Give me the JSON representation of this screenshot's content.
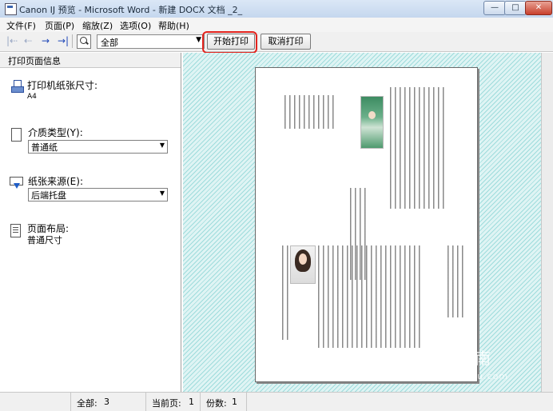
{
  "window": {
    "title": "Canon IJ 预览 - Microsoft Word - 新建 DOCX 文档 _2_",
    "controls": {
      "minimize": "—",
      "maximize": "□",
      "close": "✕"
    }
  },
  "menu": {
    "items": [
      "文件(F)",
      "页面(P)",
      "缩放(Z)",
      "选项(O)",
      "帮助(H)"
    ]
  },
  "toolbar": {
    "nav_icons": {
      "first": "|⇠",
      "prev": "⇠",
      "next": "→",
      "last": "→|"
    },
    "pages_select": "全部",
    "start_print": "开始打印",
    "cancel_print": "取消打印"
  },
  "panel": {
    "title": "打印页面信息",
    "paper_size_label": "打印机纸张尺寸:",
    "paper_size_value": "A4",
    "media_type_label": "介质类型(Y):",
    "media_type_value": "普通纸",
    "paper_source_label": "纸张来源(E):",
    "paper_source_value": "后端托盘",
    "page_layout_label": "页面布局:",
    "page_layout_value": "普通尺寸"
  },
  "watermark": {
    "text": "搜狗指南",
    "url": "zhinan.sogou.com"
  },
  "status": {
    "total_label": "全部:",
    "total_value": "3",
    "current_label": "当前页:",
    "current_value": "1",
    "copies_label": "份数:",
    "copies_value": "1"
  },
  "colors": {
    "highlight": "#e3231d",
    "preview_bg": "#dff4f4",
    "titlebar": "#c5d7ee"
  }
}
